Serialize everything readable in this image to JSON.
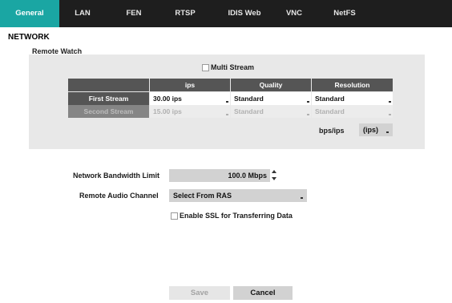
{
  "tabs": [
    {
      "label": "General",
      "active": true
    },
    {
      "label": "LAN",
      "active": false
    },
    {
      "label": "FEN",
      "active": false
    },
    {
      "label": "RTSP",
      "active": false
    },
    {
      "label": "IDIS Web",
      "active": false
    },
    {
      "label": "VNC",
      "active": false
    },
    {
      "label": "NetFS",
      "active": false
    }
  ],
  "section_title": "NETWORK",
  "remote_watch": {
    "title": "Remote Watch",
    "multi_stream_label": "Multi Stream",
    "multi_stream_checked": false,
    "columns": [
      "ips",
      "Quality",
      "Resolution"
    ],
    "rows": [
      {
        "name": "First Stream",
        "ips": "30.00 ips",
        "quality": "Standard",
        "resolution": "Standard",
        "enabled": true
      },
      {
        "name": "Second Stream",
        "ips": "15.00 ips",
        "quality": "Standard",
        "resolution": "Standard",
        "enabled": false
      }
    ],
    "unit_label": "bps/ips",
    "unit_value": "(ips)"
  },
  "bandwidth": {
    "label": "Network Bandwidth Limit",
    "value": "100.0 Mbps"
  },
  "audio": {
    "label": "Remote Audio Channel",
    "value": "Select From RAS"
  },
  "ssl": {
    "label": "Enable SSL for Transferring Data",
    "checked": false
  },
  "buttons": {
    "save": "Save",
    "cancel": "Cancel"
  },
  "colors": {
    "accent": "#1aa6a3",
    "tabbar": "#1e1e1e",
    "header": "#555555"
  }
}
